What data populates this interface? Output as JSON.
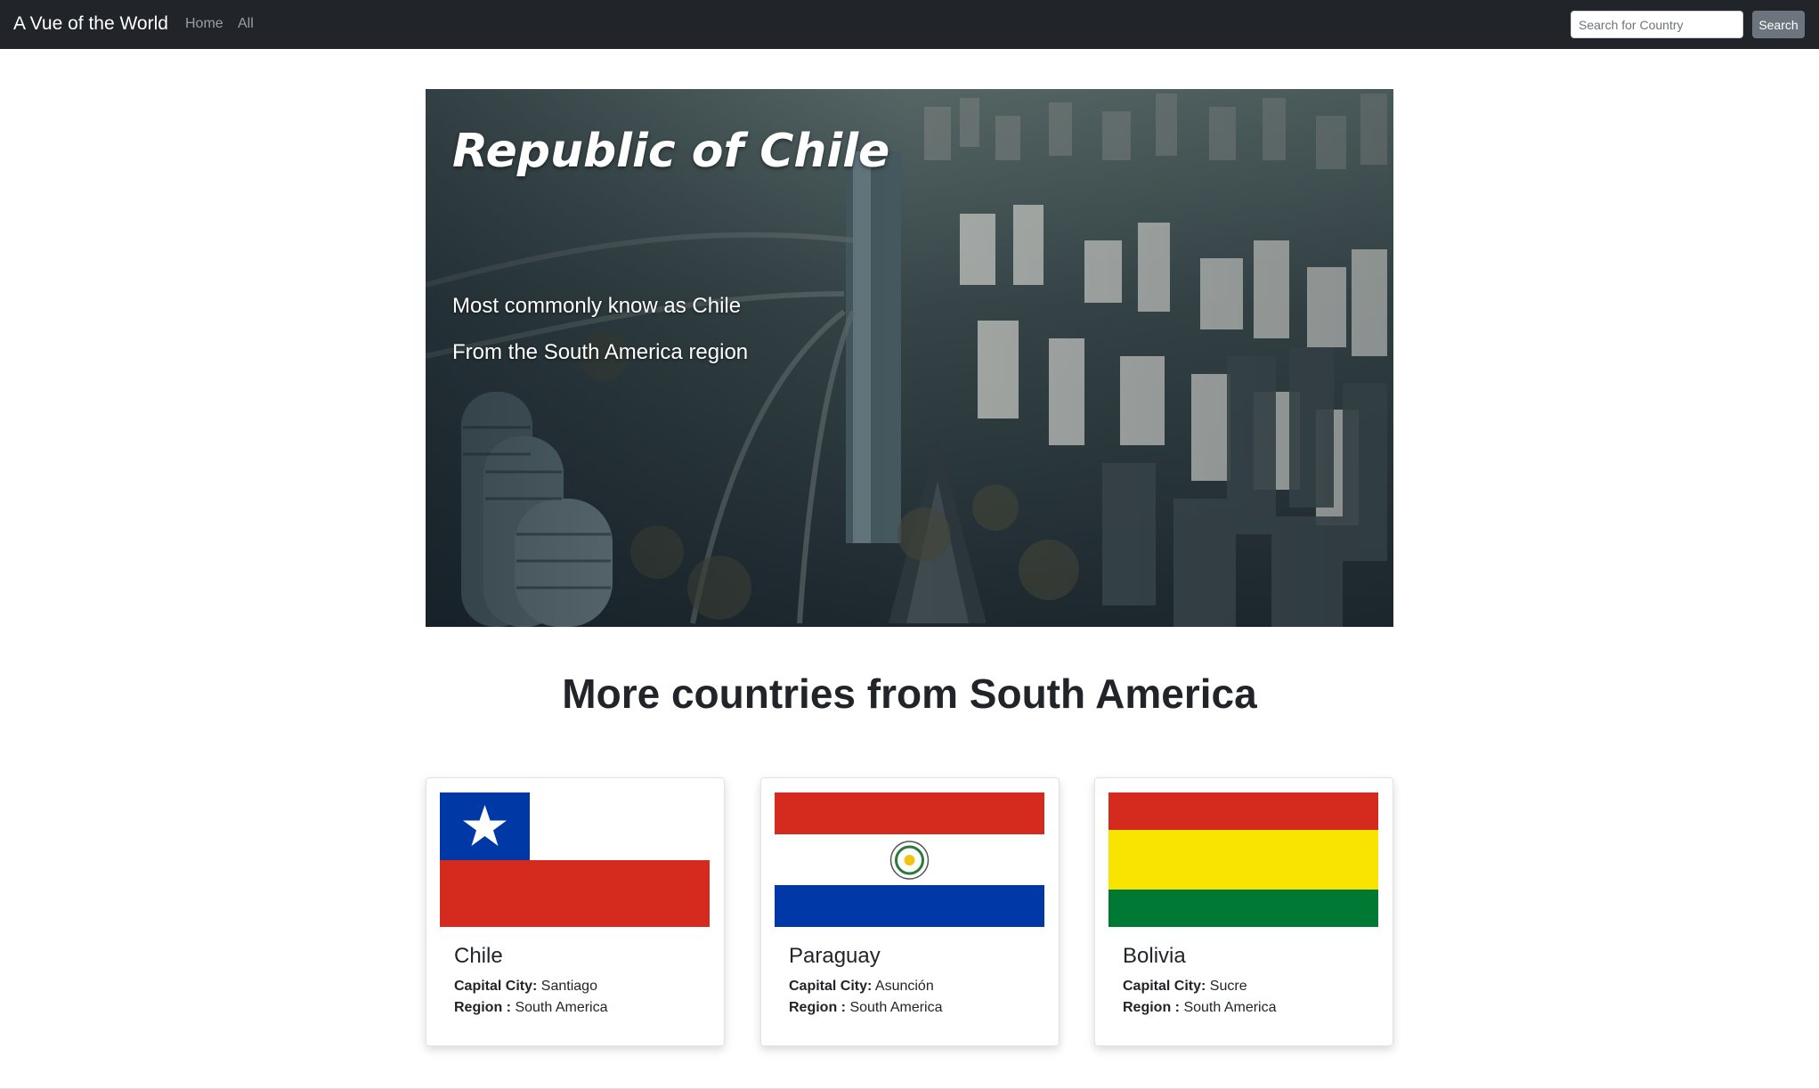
{
  "navbar": {
    "brand": "A Vue of the World",
    "links": [
      {
        "label": "Home"
      },
      {
        "label": "All"
      }
    ],
    "search": {
      "placeholder": "Search for Country",
      "value": "",
      "button_label": "Search"
    }
  },
  "hero": {
    "title": "Republic of Chile",
    "subtitle_1": "Most commonly know as Chile",
    "subtitle_2": "From the South America region",
    "image": "aerial-city-skyline-image"
  },
  "section": {
    "title": "More countries from South America"
  },
  "cards": [
    {
      "name": "Chile",
      "capital_label": "Capital City:",
      "capital": "Santiago",
      "region_label": "Region :",
      "region": "South America",
      "flag": "chile-flag",
      "colors": [
        "#0039a6",
        "#ffffff",
        "#d52b1e"
      ]
    },
    {
      "name": "Paraguay",
      "capital_label": "Capital City:",
      "capital": "Asunción",
      "region_label": "Region :",
      "region": "South America",
      "flag": "paraguay-flag",
      "colors": [
        "#d52b1e",
        "#ffffff",
        "#0038a8"
      ]
    },
    {
      "name": "Bolivia",
      "capital_label": "Capital City:",
      "capital": "Sucre",
      "region_label": "Region :",
      "region": "South America",
      "flag": "bolivia-flag",
      "colors": [
        "#d52b1e",
        "#f9e300",
        "#007934"
      ]
    }
  ]
}
